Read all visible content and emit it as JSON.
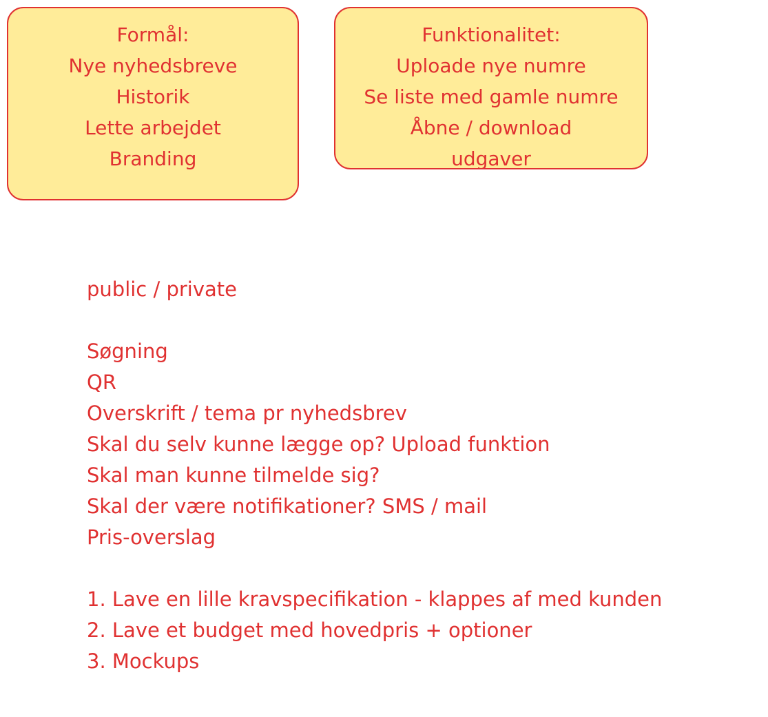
{
  "purpose_note": {
    "lines": [
      "Formål:",
      "Nye nyhedsbreve",
      "Historik",
      "Lette arbejdet",
      "Branding"
    ]
  },
  "functionality_note": {
    "lines": [
      "Funktionalitet:",
      "Uploade nye numre",
      "Se liste med gamle numre",
      "Åbne / download",
      "udgaver"
    ]
  },
  "notes": {
    "visibility": "public / private",
    "features": [
      "Søgning",
      "QR",
      "Overskrift / tema pr nyhedsbrev",
      "Skal du selv kunne lægge op? Upload funktion",
      "Skal man kunne tilmelde sig?",
      "Skal der være notifikationer? SMS / mail",
      "Pris-overslag"
    ],
    "steps": [
      "1. Lave en lille kravspecifikation - klappes af med kunden",
      "2. Lave et budget med hovedpris + optioner",
      "3. Mockups"
    ]
  },
  "colors": {
    "stroke": "#e03131",
    "sticky_fill": "#ffec99",
    "background": "#ffffff"
  }
}
